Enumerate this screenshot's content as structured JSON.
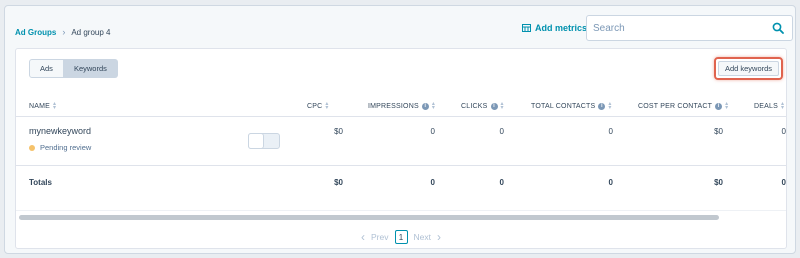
{
  "breadcrumb": {
    "parent": "Ad Groups",
    "separator": "›",
    "current": "Ad group 4"
  },
  "header": {
    "add_metrics_label": "Add metrics",
    "search_placeholder": "Search"
  },
  "view_toggle": {
    "options": [
      "Ads",
      "Keywords"
    ],
    "selected": "Keywords"
  },
  "add_keywords_label": "Add keywords",
  "table": {
    "columns": [
      "NAME",
      "CPC",
      "IMPRESSIONS",
      "CLICKS",
      "TOTAL CONTACTS",
      "COST PER CONTACT",
      "DEALS"
    ],
    "rows": [
      {
        "name": "mynewkeyword",
        "status": "Pending review",
        "cpc": "$0",
        "impressions": "0",
        "clicks": "0",
        "total_contacts": "0",
        "cost_per_contact": "$0",
        "deals": "0"
      }
    ],
    "totals": {
      "label": "Totals",
      "cpc": "$0",
      "impressions": "0",
      "clicks": "0",
      "total_contacts": "0",
      "cost_per_contact": "$0",
      "deals": "0"
    }
  },
  "pagination": {
    "prev_label": "Prev",
    "current_page": "1",
    "next_label": "Next"
  },
  "colors": {
    "accent": "#0091ae",
    "highlight": "#e0634e",
    "pending_dot": "#f5c26b"
  }
}
